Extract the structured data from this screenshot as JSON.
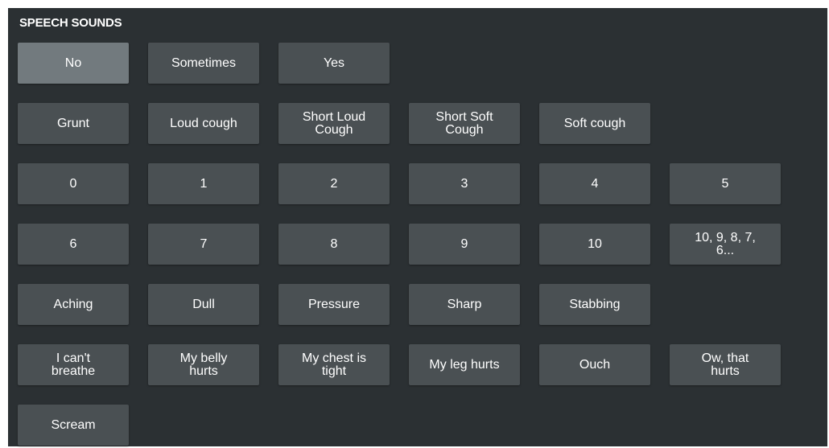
{
  "panel": {
    "title": "SPEECH SOUNDS"
  },
  "colors": {
    "panel_background": "#2b3033",
    "button_background": "#4a5053",
    "button_selected_background": "#727a7e",
    "text": "#ffffff"
  },
  "rows": [
    [
      {
        "label": "No",
        "selected": true
      },
      {
        "label": "Sometimes"
      },
      {
        "label": "Yes"
      }
    ],
    [
      {
        "label": "Grunt"
      },
      {
        "label": "Loud cough"
      },
      {
        "label": "Short Loud\nCough"
      },
      {
        "label": "Short Soft\nCough"
      },
      {
        "label": "Soft cough"
      }
    ],
    [
      {
        "label": "0"
      },
      {
        "label": "1"
      },
      {
        "label": "2"
      },
      {
        "label": "3"
      },
      {
        "label": "4"
      },
      {
        "label": "5"
      }
    ],
    [
      {
        "label": "6"
      },
      {
        "label": "7"
      },
      {
        "label": "8"
      },
      {
        "label": "9"
      },
      {
        "label": "10"
      },
      {
        "label": "10, 9, 8, 7,\n6..."
      }
    ],
    [
      {
        "label": "Aching"
      },
      {
        "label": "Dull"
      },
      {
        "label": "Pressure"
      },
      {
        "label": "Sharp"
      },
      {
        "label": "Stabbing"
      }
    ],
    [
      {
        "label": "I can't\nbreathe"
      },
      {
        "label": "My belly\nhurts"
      },
      {
        "label": "My chest is\ntight"
      },
      {
        "label": "My leg hurts"
      },
      {
        "label": "Ouch"
      },
      {
        "label": "Ow, that\nhurts"
      }
    ],
    [
      {
        "label": "Scream"
      }
    ]
  ]
}
